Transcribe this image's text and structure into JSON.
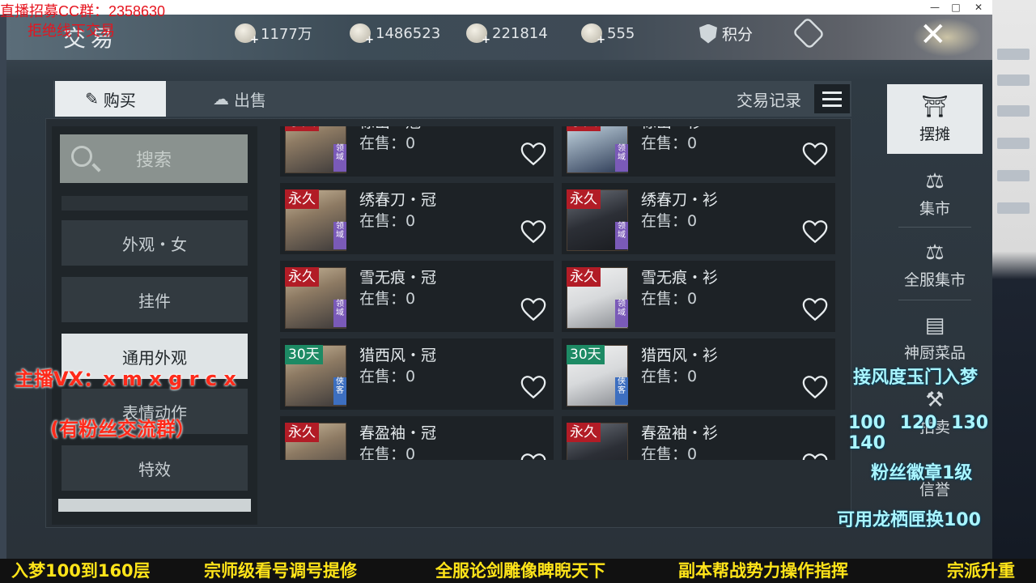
{
  "overlay": {
    "top_left_1": "直播招募CC群：2358630",
    "top_left_2": "拒绝线下交易",
    "vx": "主播VX：x m x g r c x",
    "fan_group": "(有粉丝交流群）",
    "right_1": "接风度玉门入梦",
    "right_2": "100 120 130 140",
    "right_3": "粉丝徽章1级",
    "right_4": "可用龙栖匣换100",
    "ticker": [
      "入梦100到160层",
      "宗师级看号调号提修",
      "全服论剑雕像睥睨天下",
      "副本帮战势力操作指挥",
      "宗派升重"
    ]
  },
  "window": {
    "min": "—",
    "max": "□",
    "close": "✕"
  },
  "header": {
    "title": "交易",
    "resources": [
      {
        "icon": "coin-icon",
        "value": "1177万"
      },
      {
        "icon": "silver-ingot-icon",
        "value": "1486523"
      },
      {
        "icon": "jade-icon",
        "value": "221814"
      },
      {
        "icon": "gold-ingot-icon",
        "value": "555"
      }
    ],
    "score_label": "积分",
    "close_glyph": "✕"
  },
  "tabs": {
    "buy": "购买",
    "sell": "出售",
    "record": "交易记录"
  },
  "search_label": "搜索",
  "categories": [
    {
      "label": "外观・女",
      "active": false
    },
    {
      "label": "挂件",
      "active": false
    },
    {
      "label": "通用外观",
      "active": true
    },
    {
      "label": "表情动作",
      "active": false
    },
    {
      "label": "特效",
      "active": false
    }
  ],
  "items": [
    {
      "name": "惊出・冠",
      "sale": "在售：0",
      "tag": "永久",
      "side": "领域",
      "type": "perm",
      "skin": "face",
      "sidec": "purple"
    },
    {
      "name": "惊出・衫",
      "sale": "在售：0",
      "tag": "永久",
      "side": "领域",
      "type": "perm",
      "skin": "cloth",
      "sidec": "purple"
    },
    {
      "name": "绣春刀・冠",
      "sale": "在售：0",
      "tag": "永久",
      "side": "领域",
      "type": "perm",
      "skin": "face",
      "sidec": "purple"
    },
    {
      "name": "绣春刀・衫",
      "sale": "在售：0",
      "tag": "永久",
      "side": "领域",
      "type": "perm",
      "skin": "dark",
      "sidec": "purple"
    },
    {
      "name": "雪无痕・冠",
      "sale": "在售：0",
      "tag": "永久",
      "side": "领域",
      "type": "perm",
      "skin": "face",
      "sidec": "purple"
    },
    {
      "name": "雪无痕・衫",
      "sale": "在售：0",
      "tag": "永久",
      "side": "领域",
      "type": "perm",
      "skin": "white",
      "sidec": "purple"
    },
    {
      "name": "猎西风・冠",
      "sale": "在售：0",
      "tag": "30天",
      "side": "侠客",
      "type": "days",
      "skin": "face",
      "sidec": "blue"
    },
    {
      "name": "猎西风・衫",
      "sale": "在售：0",
      "tag": "30天",
      "side": "侠客",
      "type": "days",
      "skin": "white",
      "sidec": "blue"
    },
    {
      "name": "春盈袖・冠",
      "sale": "在售：0",
      "tag": "永久",
      "side": "",
      "type": "perm",
      "skin": "face",
      "sidec": ""
    },
    {
      "name": "春盈袖・衫",
      "sale": "在售：0",
      "tag": "永久",
      "side": "",
      "type": "perm",
      "skin": "dark",
      "sidec": ""
    }
  ],
  "right_nav": [
    {
      "label": "摆摊",
      "glyph": "⛩",
      "active": true
    },
    {
      "label": "集市",
      "glyph": "⚖",
      "active": false
    },
    {
      "label": "全服集市",
      "glyph": "⚖",
      "active": false
    },
    {
      "label": "神厨菜品",
      "glyph": "▤",
      "active": false
    },
    {
      "label": "拍卖",
      "glyph": "⚒",
      "active": false
    },
    {
      "label": "信誉",
      "glyph": "",
      "active": false
    }
  ]
}
